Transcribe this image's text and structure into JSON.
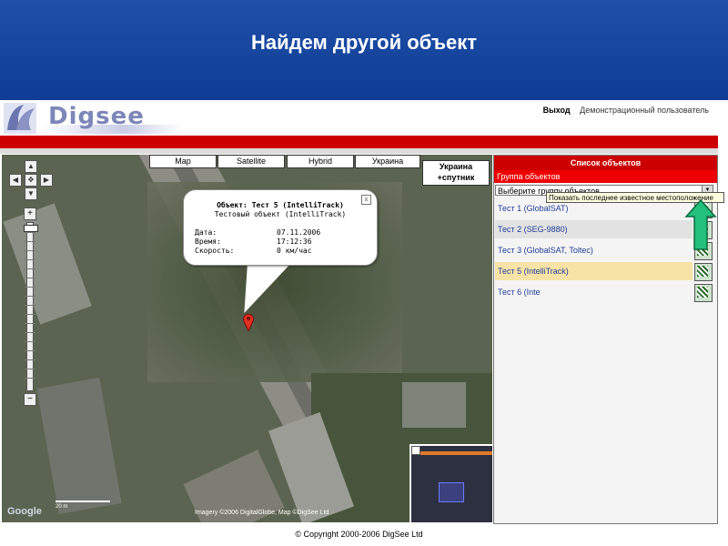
{
  "slide": {
    "title": "Найдем другой объект"
  },
  "brand": {
    "logo_text": "Digsee"
  },
  "topnav": {
    "logout": "Выход",
    "user": "Демонстрационный пользователь"
  },
  "map": {
    "types": [
      "Map",
      "Satellite",
      "Hybrid",
      "Украина"
    ],
    "active_type_line1": "Украина",
    "active_type_line2": "+спутник",
    "scale_label": "20 m",
    "imagery_credit": "Imagery ©2006 DigitalGlobe, Map ©DigSee Ltd",
    "google": "Google",
    "popup": {
      "title": "Объект: Тест 5 (IntelliTrack)",
      "subtitle": "Тестовый объект (IntelliTrack)",
      "rows": [
        {
          "label": "Дата:",
          "value": "07.11.2006"
        },
        {
          "label": "Время:",
          "value": "17:12:36"
        },
        {
          "label": "Скорость:",
          "value": "0 км/час"
        }
      ],
      "close": "x"
    }
  },
  "sidepanel": {
    "header": "Список объектов",
    "group_label": "Группа объектов",
    "group_select": "Выберите группу объектов",
    "objects": [
      {
        "name": "Тест 1 (GlobalSAT)",
        "highlight": false
      },
      {
        "name": "Тест 2 (SEG-9880)",
        "highlight": false
      },
      {
        "name": "Тест 3 (GlobalSAT, Toltec)",
        "highlight": false
      },
      {
        "name": "Тест 5 (IntelliTrack)",
        "highlight": true
      },
      {
        "name": "Тест 6 (Inte",
        "highlight": false
      }
    ],
    "tooltip": "Показать последнее известное местоположение"
  },
  "footer": {
    "copyright": "© Copyright 2000-2006 DigSee Ltd"
  },
  "colors": {
    "slide_header": "#1f4fa8",
    "brand_red": "#cc0000",
    "highlight_row": "#f7e3a6",
    "link": "#1f3d99",
    "arrow": "#22c07a"
  }
}
